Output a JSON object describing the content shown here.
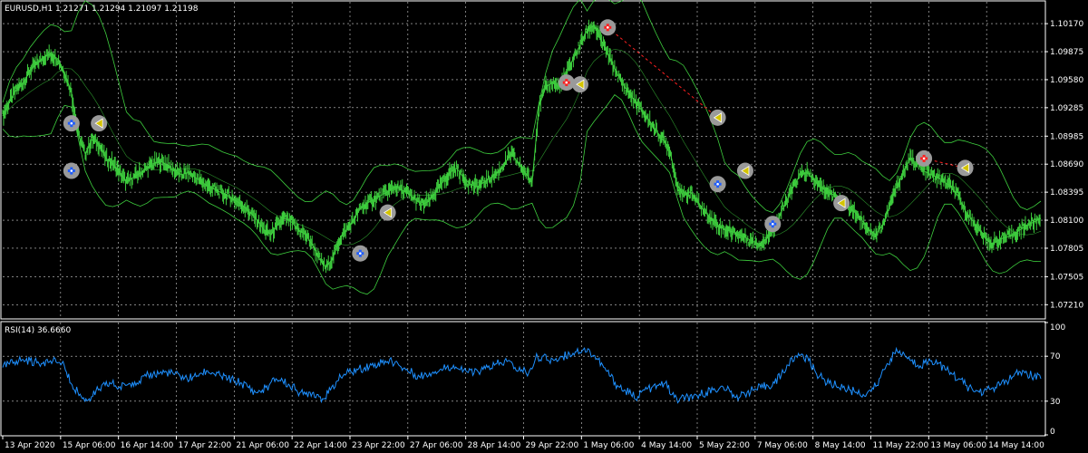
{
  "colors": {
    "background": "#000000",
    "grid": "#d0d0d0",
    "axis": "#ffffff",
    "price": "#3ecf3e",
    "bands": "#3ecf3e",
    "rsi": "#1e90ff",
    "trade_line": "#ff2020",
    "buy": "#1e5cff",
    "sell": "#ff2020",
    "close_marker": "#d4c400",
    "marker_bg": "#9a9a9a"
  },
  "chart_data": [
    {
      "type": "line",
      "title": "EURUSD,H1  1.21271 1.21294 1.21097 1.21198",
      "grid": true,
      "ylim": [
        1.0707,
        1.104
      ],
      "y_ticks": [
        "1.10170",
        "1.09875",
        "1.09580",
        "1.09285",
        "1.08985",
        "1.08690",
        "1.08395",
        "1.08100",
        "1.07805",
        "1.07505",
        "1.07210"
      ],
      "x_ticks": [
        "13 Apr 2020",
        "15 Apr 06:00",
        "16 Apr 14:00",
        "17 Apr 22:00",
        "21 Apr 06:00",
        "22 Apr 14:00",
        "23 Apr 22:00",
        "27 Apr 06:00",
        "28 Apr 14:00",
        "29 Apr 22:00",
        "1 May 06:00",
        "4 May 14:00",
        "5 May 22:00",
        "7 May 06:00",
        "8 May 14:00",
        "11 May 22:00",
        "13 May 06:00",
        "14 May 14:00"
      ],
      "series": [
        {
          "values": [
            1.092,
            1.0935,
            1.0948,
            1.0955,
            1.0968,
            1.0975,
            1.0982,
            1.0985,
            1.098,
            1.0965,
            1.0945,
            1.09,
            1.088,
            1.0895,
            1.089,
            1.0875,
            1.087,
            1.086,
            1.085,
            1.0855,
            1.086,
            1.0865,
            1.087,
            1.0872,
            1.0868,
            1.0862,
            1.0858,
            1.086,
            1.0855,
            1.085,
            1.0845,
            1.0842,
            1.0838,
            1.0835,
            1.083,
            1.0825,
            1.0818,
            1.081,
            1.08,
            1.0795,
            1.0805,
            1.0812,
            1.0808,
            1.08,
            1.0795,
            1.0785,
            1.077,
            1.076,
            1.077,
            1.079,
            1.08,
            1.081,
            1.0822,
            1.0828,
            1.0832,
            1.0836,
            1.084,
            1.0845,
            1.0842,
            1.0838,
            1.0832,
            1.0826,
            1.083,
            1.084,
            1.085,
            1.086,
            1.0865,
            1.0855,
            1.0848,
            1.0845,
            1.085,
            1.0855,
            1.086,
            1.087,
            1.088,
            1.087,
            1.086,
            1.085,
            1.093,
            1.095,
            1.0955,
            1.095,
            1.0965,
            1.098,
            1.0995,
            1.101,
            1.1015,
            1.1,
            1.0985,
            1.097,
            1.0955,
            1.0945,
            1.0935,
            1.0925,
            1.0915,
            1.0905,
            1.0895,
            1.0885,
            1.085,
            1.0835,
            1.084,
            1.083,
            1.082,
            1.0812,
            1.0805,
            1.08,
            1.0798,
            1.0795,
            1.0792,
            1.0788,
            1.0785,
            1.079,
            1.08,
            1.0815,
            1.083,
            1.0845,
            1.0858,
            1.086,
            1.0852,
            1.0845,
            1.084,
            1.0836,
            1.083,
            1.0825,
            1.0818,
            1.081,
            1.08,
            1.0795,
            1.0805,
            1.0825,
            1.0845,
            1.086,
            1.0875,
            1.087,
            1.0862,
            1.0858,
            1.0855,
            1.085,
            1.0845,
            1.0835,
            1.082,
            1.081,
            1.08,
            1.079,
            1.0785,
            1.079,
            1.0792,
            1.0795,
            1.08,
            1.0805,
            1.0808,
            1.0812
          ]
        }
      ]
    },
    {
      "type": "line",
      "title": "RSI(14) 36.6660",
      "grid": true,
      "ylim": [
        0,
        100
      ],
      "y_ticks": [
        "100",
        "70",
        "30",
        "0"
      ],
      "series": [
        {
          "values": [
            60,
            63,
            66,
            67,
            66,
            64,
            65,
            66,
            64,
            62,
            46,
            38,
            30,
            34,
            40,
            44,
            46,
            42,
            44,
            47,
            48,
            52,
            54,
            55,
            56,
            54,
            52,
            50,
            52,
            55,
            57,
            54,
            52,
            50,
            48,
            46,
            42,
            38,
            40,
            44,
            50,
            48,
            44,
            40,
            36,
            38,
            36,
            32,
            40,
            48,
            54,
            56,
            58,
            60,
            62,
            64,
            66,
            65,
            62,
            58,
            55,
            52,
            54,
            56,
            58,
            60,
            62,
            58,
            56,
            55,
            57,
            60,
            62,
            64,
            66,
            60,
            58,
            55,
            68,
            70,
            66,
            68,
            70,
            72,
            74,
            76,
            74,
            68,
            60,
            52,
            44,
            40,
            36,
            34,
            40,
            42,
            44,
            46,
            36,
            30,
            34,
            32,
            36,
            38,
            40,
            42,
            40,
            36,
            34,
            38,
            40,
            42,
            44,
            46,
            54,
            62,
            70,
            72,
            66,
            56,
            50,
            46,
            44,
            42,
            40,
            38,
            36,
            40,
            44,
            58,
            68,
            74,
            72,
            66,
            62,
            64,
            66,
            64,
            58,
            54,
            50,
            44,
            40,
            38,
            40,
            42,
            44,
            48,
            52,
            56,
            54,
            52,
            50
          ]
        }
      ]
    }
  ],
  "trade_markers": [
    {
      "type": "buy",
      "i": 5,
      "price": 1.0912
    },
    {
      "type": "close",
      "i": 7,
      "price": 1.0912
    },
    {
      "type": "buy",
      "i": 5,
      "price": 1.0862
    },
    {
      "type": "close",
      "i": 28,
      "price": 1.0818
    },
    {
      "type": "buy",
      "i": 26,
      "price": 1.0775
    },
    {
      "type": "sell",
      "i": 44,
      "price": 1.1013
    },
    {
      "type": "sell",
      "i": 41,
      "price": 1.0955
    },
    {
      "type": "close",
      "i": 42,
      "price": 1.0953
    },
    {
      "type": "close",
      "i": 52,
      "price": 1.0918
    },
    {
      "type": "buy",
      "i": 52,
      "price": 1.0848
    },
    {
      "type": "close",
      "i": 54,
      "price": 1.0862
    },
    {
      "type": "buy",
      "i": 56,
      "price": 1.0806
    },
    {
      "type": "close",
      "i": 61,
      "price": 1.0828
    },
    {
      "type": "sell",
      "i": 67,
      "price": 1.0875
    },
    {
      "type": "close",
      "i": 70,
      "price": 1.0865
    }
  ],
  "trade_lines": [
    {
      "from": {
        "i": 44,
        "price": 1.1013
      },
      "to": {
        "i": 52,
        "price": 1.0918
      }
    },
    {
      "from": {
        "i": 67,
        "price": 1.0875
      },
      "to": {
        "i": 70,
        "price": 1.0865
      }
    }
  ]
}
